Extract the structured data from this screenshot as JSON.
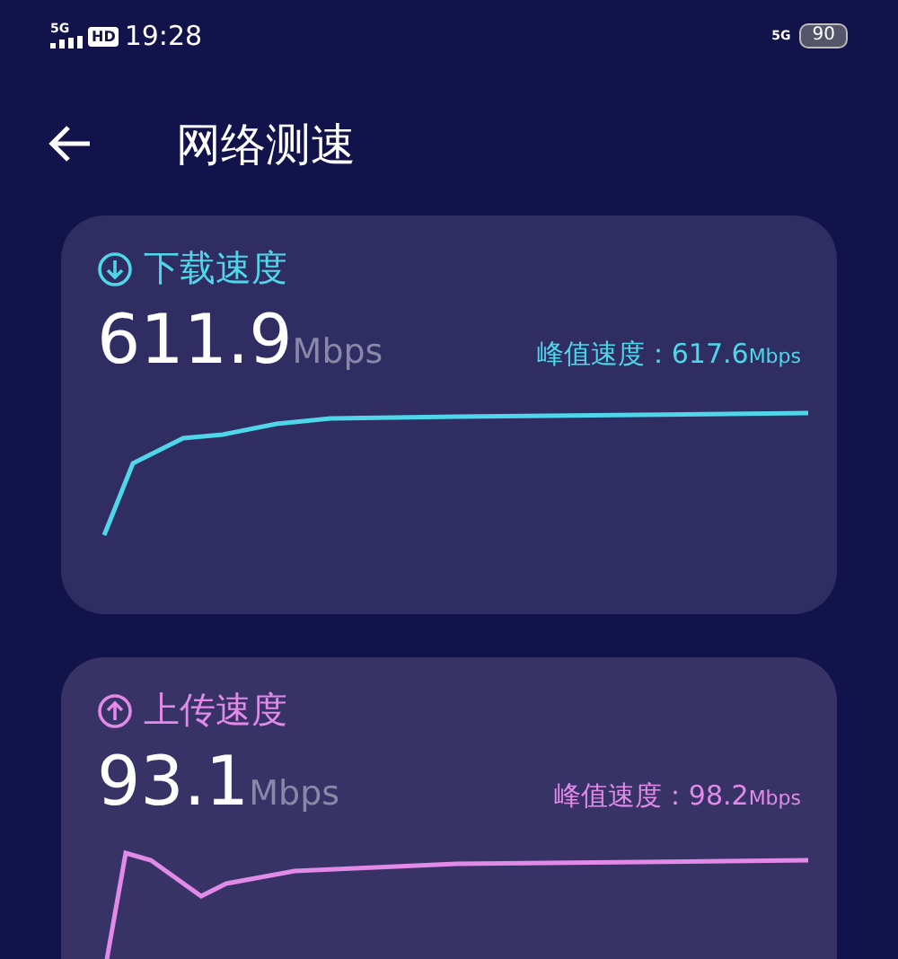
{
  "status_bar": {
    "network_left": "5G",
    "hd": "HD",
    "time": "19:28",
    "network_right": "5G",
    "battery": "90"
  },
  "header": {
    "title": "网络测速"
  },
  "cards": [
    {
      "kind": "download",
      "color": "#4fd6e8",
      "title": "下载速度",
      "value": "611.9",
      "unit": "Mbps",
      "peak_label": "峰值速度：",
      "peak_value": "617.6",
      "peak_unit": "Mbps"
    },
    {
      "kind": "upload",
      "color": "#e28ae8",
      "title": "上传速度",
      "value": "93.1",
      "unit": "Mbps",
      "peak_label": "峰值速度：",
      "peak_value": "98.2",
      "peak_unit": "Mbps"
    }
  ]
}
